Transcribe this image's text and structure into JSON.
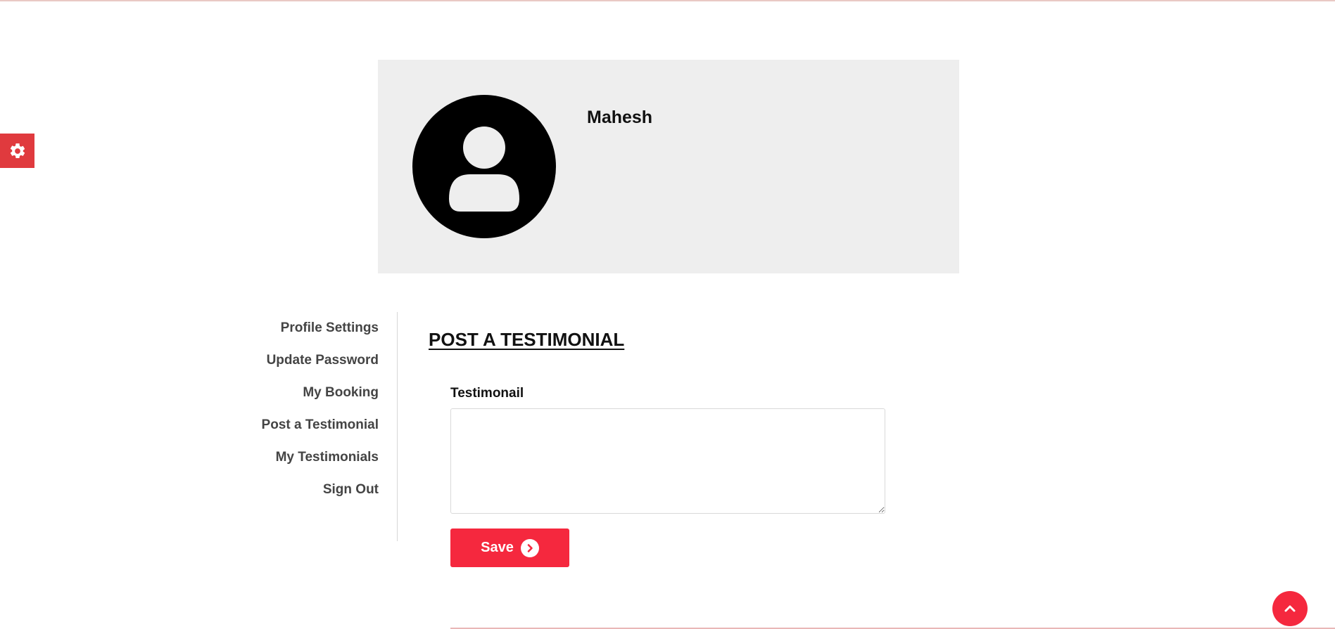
{
  "colors": {
    "accent": "#f5283e",
    "settings_tab": "#e03a3e",
    "card_background": "#eeeeee"
  },
  "settings": {
    "icon": "gear-icon"
  },
  "profile": {
    "name": "Mahesh",
    "avatar_icon": "user-icon"
  },
  "sidebar": {
    "items": [
      {
        "label": "Profile Settings"
      },
      {
        "label": "Update Password"
      },
      {
        "label": "My Booking"
      },
      {
        "label": "Post a Testimonial"
      },
      {
        "label": "My Testimonials"
      },
      {
        "label": "Sign Out"
      }
    ]
  },
  "main": {
    "title": "POST A TESTIMONIAL",
    "field_label": "Testimonail",
    "field_value": "",
    "save_label": "Save",
    "save_icon": "chevron-right-circle-icon"
  },
  "scroll_top": {
    "icon": "chevron-up-icon"
  }
}
